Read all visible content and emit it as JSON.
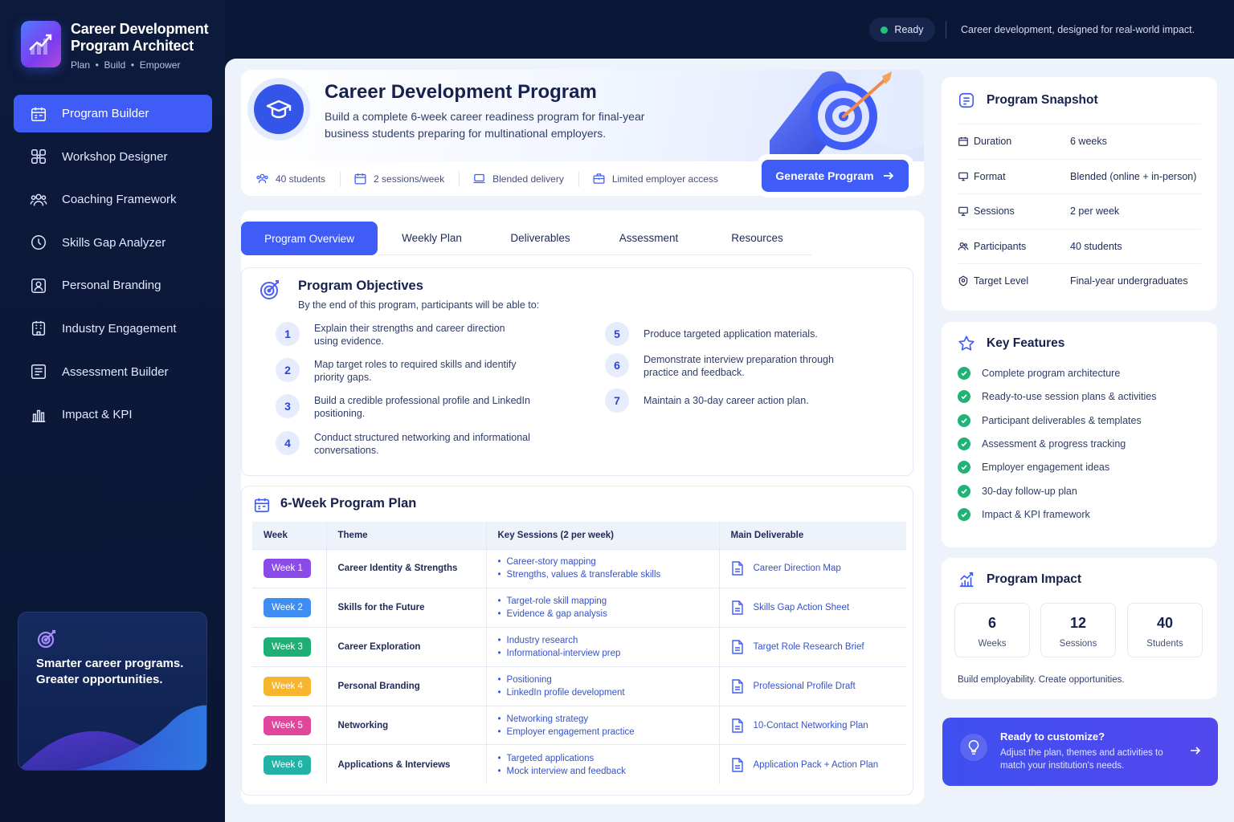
{
  "brand": {
    "title_line1": "Career Development",
    "title_line2": "Program Architect",
    "tagline": "Plan  •  Build  •  Empower"
  },
  "nav": [
    {
      "label": "Program Builder",
      "icon": "calendar-icon",
      "active": true
    },
    {
      "label": "Workshop Designer",
      "icon": "workshop-icon"
    },
    {
      "label": "Coaching Framework",
      "icon": "users-icon"
    },
    {
      "label": "Skills Gap Analyzer",
      "icon": "clock-icon"
    },
    {
      "label": "Personal Branding",
      "icon": "profile-icon"
    },
    {
      "label": "Industry Engagement",
      "icon": "building-icon"
    },
    {
      "label": "Assessment Builder",
      "icon": "checklist-icon"
    },
    {
      "label": "Impact & KPI",
      "icon": "bar-chart-icon"
    }
  ],
  "promo": {
    "text": "Smarter career programs. Greater opportunities."
  },
  "top": {
    "status": "Ready",
    "tagline": "Career development, designed for real-world impact."
  },
  "hero": {
    "title": "Career Development Program",
    "subtitle": "Build a complete 6-week career readiness program for final-year business students preparing for multinational employers.",
    "stats": [
      "40 students",
      "2 sessions/week",
      "Blended delivery",
      "Limited employer access"
    ],
    "generate_label": "Generate Program"
  },
  "tabs": [
    "Program Overview",
    "Weekly Plan",
    "Deliverables",
    "Assessment",
    "Resources"
  ],
  "objectives": {
    "title": "Program Objectives",
    "subtitle": "By the end of this program, participants will be able to:",
    "items": [
      {
        "n": "1",
        "text": "Explain their strengths and career direction using evidence."
      },
      {
        "n": "2",
        "text": "Map target roles to required skills and identify priority gaps."
      },
      {
        "n": "3",
        "text": "Build a credible professional profile and LinkedIn positioning."
      },
      {
        "n": "4",
        "text": "Conduct structured networking and informational conversations."
      },
      {
        "n": "5",
        "text": "Produce targeted application materials."
      },
      {
        "n": "6",
        "text": "Demonstrate interview preparation through practice and feedback."
      },
      {
        "n": "7",
        "text": "Maintain a 30-day career action plan."
      }
    ]
  },
  "plan": {
    "title": "6-Week Program Plan",
    "headers": [
      "Week",
      "Theme",
      "Key Sessions (2 per week)",
      "Main Deliverable"
    ],
    "rows": [
      {
        "week": "Week 1",
        "color": "#8a4be8",
        "theme": "Career Identity & Strengths",
        "s1": "Career-story mapping",
        "s2": "Strengths, values & transferable skills",
        "deliverable": "Career Direction Map"
      },
      {
        "week": "Week 2",
        "color": "#3d8ef0",
        "theme": "Skills for the Future",
        "s1": "Target-role skill mapping",
        "s2": "Evidence & gap analysis",
        "deliverable": "Skills Gap Action Sheet"
      },
      {
        "week": "Week 3",
        "color": "#1fae74",
        "theme": "Career Exploration",
        "s1": "Industry research",
        "s2": "Informational-interview prep",
        "deliverable": "Target Role Research Brief"
      },
      {
        "week": "Week 4",
        "color": "#f5b52e",
        "theme": "Personal Branding",
        "s1": "Positioning",
        "s2": "LinkedIn profile development",
        "deliverable": "Professional Profile Draft"
      },
      {
        "week": "Week 5",
        "color": "#e0479c",
        "theme": "Networking",
        "s1": "Networking strategy",
        "s2": "Employer engagement practice",
        "deliverable": "10-Contact Networking Plan"
      },
      {
        "week": "Week 6",
        "color": "#22b3a6",
        "theme": "Applications & Interviews",
        "s1": "Targeted applications",
        "s2": "Mock interview and feedback",
        "deliverable": "Application Pack + Action Plan"
      }
    ]
  },
  "snapshot": {
    "title": "Program Snapshot",
    "rows": [
      {
        "label": "Duration",
        "value": "6 weeks",
        "icon": "calendar-icon"
      },
      {
        "label": "Format",
        "value": "Blended (online + in-person)",
        "icon": "monitor-icon"
      },
      {
        "label": "Sessions",
        "value": "2 per week",
        "icon": "presentation-icon"
      },
      {
        "label": "Participants",
        "value": "40 students",
        "icon": "users-icon"
      },
      {
        "label": "Target Level",
        "value": "Final-year undergraduates",
        "icon": "target-icon"
      }
    ]
  },
  "features": {
    "title": "Key Features",
    "items": [
      "Complete program architecture",
      "Ready-to-use session plans & activities",
      "Participant deliverables & templates",
      "Assessment & progress tracking",
      "Employer engagement ideas",
      "30-day follow-up plan",
      "Impact & KPI framework"
    ]
  },
  "impact": {
    "title": "Program Impact",
    "metrics": [
      {
        "value": "6",
        "label": "Weeks"
      },
      {
        "value": "12",
        "label": "Sessions"
      },
      {
        "value": "40",
        "label": "Students"
      }
    ],
    "footer": "Build employability. Create opportunities."
  },
  "cta": {
    "title": "Ready to customize?",
    "subtitle": "Adjust the plan, themes and activities to match your institution's needs."
  }
}
